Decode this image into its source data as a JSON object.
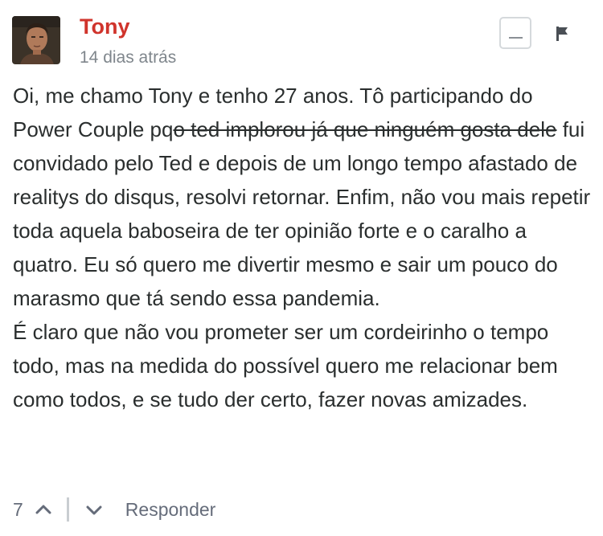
{
  "comment": {
    "author": "Tony",
    "timestamp": "14 dias atrás",
    "body": {
      "p1_before_strike": "Oi, me chamo Tony e tenho 27 anos. Tô participando do Power Couple pq",
      "p1_strike": "o ted implorou já que ninguém gosta dele",
      "p1_after_strike": " fui convidado pelo Ted e depois de um longo tempo afastado de realitys do disqus, resolvi retornar. Enfim, não vou mais repetir toda aquela baboseira de ter opinião forte e o caralho a quatro. Eu só quero me divertir mesmo e sair um pouco do marasmo que tá sendo essa pandemia.",
      "p2": "É claro que não vou prometer ser um cordeirinho o tempo todo, mas na medida do possível quero me relacionar bem como todos, e se tudo der certo, fazer novas amizades."
    },
    "votes": "7",
    "reply_label": "Responder",
    "icons": {
      "collapse": "minus-icon",
      "flag": "flag-icon",
      "upvote": "chevron-up-icon",
      "downvote": "chevron-down-icon"
    }
  },
  "colors": {
    "author": "#d0342c",
    "muted": "#7f868c",
    "text": "#2a2e2e"
  }
}
